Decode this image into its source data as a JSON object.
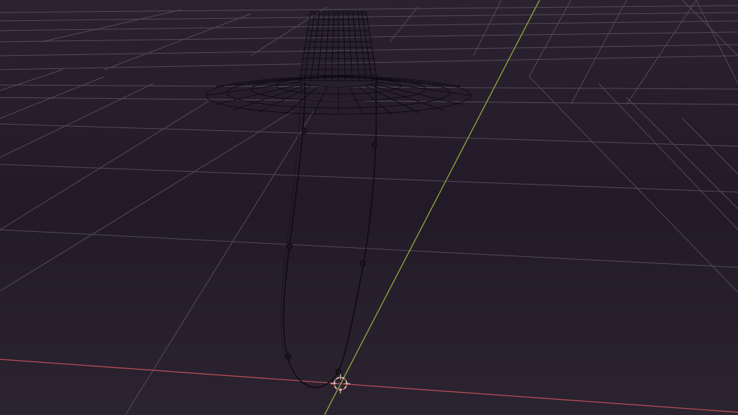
{
  "viewport": {
    "mode": "3d-viewport-wireframe",
    "background_top": "#2a2230",
    "background_mid": "#221a28",
    "background_bottom": "#2b2430",
    "grid_color": "#5c5564",
    "x_axis_color": "#c8505a",
    "y_axis_color": "#8aa83a",
    "wire_color": "#0e0a12",
    "cursor_ring_color": "#e6e6e6",
    "cursor_dash_color": "#c83c3c"
  },
  "scene": {
    "objects": [
      {
        "type": "mesh",
        "shape": "hat-crown",
        "icon": "hat-icon"
      },
      {
        "type": "mesh",
        "shape": "hat-brim",
        "icon": "hat-icon"
      },
      {
        "type": "curve",
        "shape": "hanging-string-loop",
        "icon": "curve-icon"
      }
    ],
    "cursor_icon": "3d-cursor-icon"
  }
}
